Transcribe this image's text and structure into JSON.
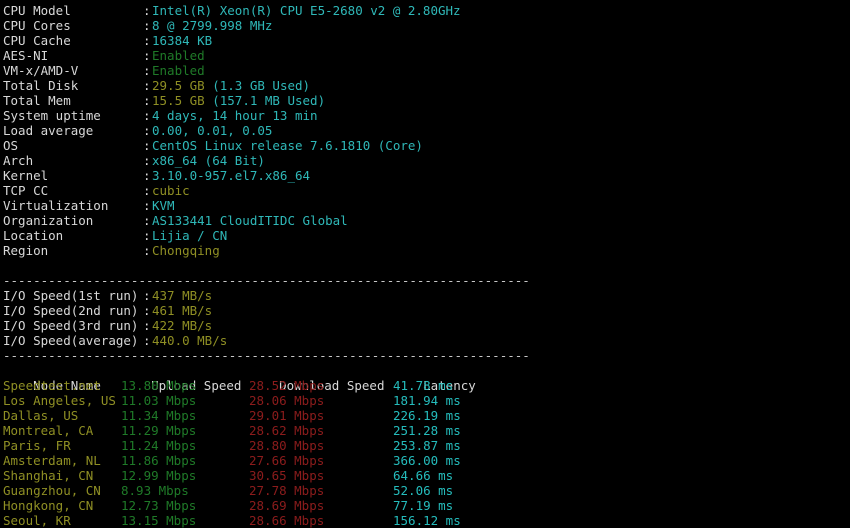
{
  "terminal": {
    "background": "#000000",
    "foreground": "#d8d8d8",
    "accent_cyan": "#2fb8b8",
    "accent_green": "#1f7a28",
    "accent_yellow": "#8f8f24",
    "accent_red": "#8c1c1c"
  },
  "separator": "----------------------------------------------------------------------",
  "sysinfo": {
    "colon": ":",
    "rows": [
      {
        "label": "CPU Model",
        "value": "Intel(R) Xeon(R) CPU E5-2680 v2 @ 2.80GHz",
        "color": "cyan"
      },
      {
        "label": "CPU Cores",
        "value": "8 @ 2799.998 MHz",
        "color": "cyan"
      },
      {
        "label": "CPU Cache",
        "value": "16384 KB",
        "color": "cyan"
      },
      {
        "label": "AES-NI",
        "value": "Enabled",
        "color": "green"
      },
      {
        "label": "VM-x/AMD-V",
        "value": "Enabled",
        "color": "green"
      },
      {
        "label": "Total Disk",
        "value": "29.5 GB",
        "value2": " (1.3 GB Used)",
        "color": "yellow",
        "color2": "cyan"
      },
      {
        "label": "Total Mem",
        "value": "15.5 GB",
        "value2": " (157.1 MB Used)",
        "color": "yellow",
        "color2": "cyan"
      },
      {
        "label": "System uptime",
        "value": "4 days, 14 hour 13 min",
        "color": "cyan"
      },
      {
        "label": "Load average",
        "value": "0.00, 0.01, 0.05",
        "color": "cyan"
      },
      {
        "label": "OS",
        "value": "CentOS Linux release 7.6.1810 (Core)",
        "color": "cyan"
      },
      {
        "label": "Arch",
        "value": "x86_64 (64 Bit)",
        "color": "cyan"
      },
      {
        "label": "Kernel",
        "value": "3.10.0-957.el7.x86_64",
        "color": "cyan"
      },
      {
        "label": "TCP CC",
        "value": "cubic",
        "color": "yellow"
      },
      {
        "label": "Virtualization",
        "value": "KVM",
        "color": "cyan"
      },
      {
        "label": "Organization",
        "value": "AS133441 CloudITIDC Global",
        "color": "cyan"
      },
      {
        "label": "Location",
        "value": "Lijia / CN",
        "color": "cyan"
      },
      {
        "label": "Region",
        "value": "Chongqing",
        "color": "yellow"
      }
    ]
  },
  "iospeed": {
    "colon": ":",
    "rows": [
      {
        "label": "I/O Speed(1st run)",
        "value": "437 MB/s"
      },
      {
        "label": "I/O Speed(2nd run)",
        "value": "461 MB/s"
      },
      {
        "label": "I/O Speed(3rd run)",
        "value": "422 MB/s"
      },
      {
        "label": "I/O Speed(average)",
        "value": "440.0 MB/s"
      }
    ]
  },
  "speedtest": {
    "headers": {
      "node": "Node Name",
      "upload": "Upload Speed",
      "download": "Download Speed",
      "latency": "Latency"
    },
    "rows": [
      {
        "node": "Speedtest.net",
        "upload": "13.80 Mbps",
        "download": "28.52 Mbps",
        "latency": "41.78 ms"
      },
      {
        "node": "Los Angeles, US",
        "upload": "11.03 Mbps",
        "download": "28.06 Mbps",
        "latency": "181.94 ms"
      },
      {
        "node": "Dallas, US",
        "upload": "11.34 Mbps",
        "download": "29.01 Mbps",
        "latency": "226.19 ms"
      },
      {
        "node": "Montreal, CA",
        "upload": "11.29 Mbps",
        "download": "28.62 Mbps",
        "latency": "251.28 ms"
      },
      {
        "node": "Paris, FR",
        "upload": "11.24 Mbps",
        "download": "28.80 Mbps",
        "latency": "253.87 ms"
      },
      {
        "node": "Amsterdam, NL",
        "upload": "11.86 Mbps",
        "download": "27.66 Mbps",
        "latency": "366.00 ms"
      },
      {
        "node": "Shanghai, CN",
        "upload": "12.99 Mbps",
        "download": "30.65 Mbps",
        "latency": "64.66 ms"
      },
      {
        "node": "Guangzhou, CN",
        "upload": "8.93 Mbps",
        "download": "27.78 Mbps",
        "latency": "52.06 ms"
      },
      {
        "node": "Hongkong, CN",
        "upload": "12.73 Mbps",
        "download": "28.69 Mbps",
        "latency": "77.19 ms"
      },
      {
        "node": "Seoul, KR",
        "upload": "13.15 Mbps",
        "download": "28.66 Mbps",
        "latency": "156.12 ms"
      }
    ]
  }
}
